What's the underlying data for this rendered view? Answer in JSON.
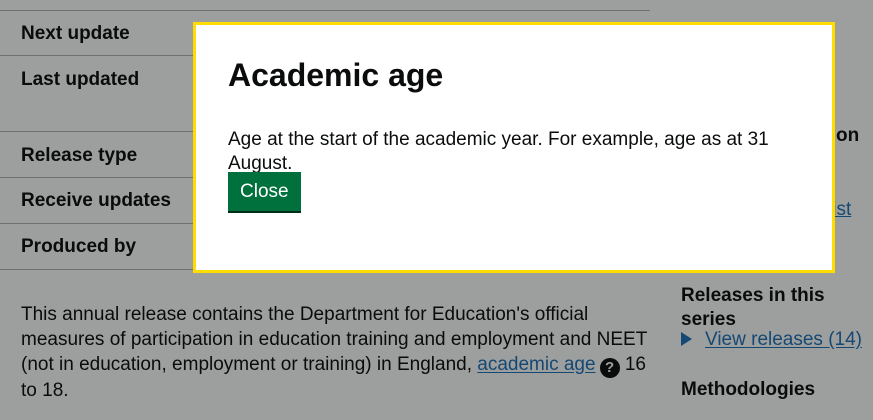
{
  "summary": {
    "rows": [
      {
        "key": "Next update"
      },
      {
        "key": "Last updated"
      },
      {
        "key": "Release type"
      },
      {
        "key": "Receive updates"
      },
      {
        "key": "Produced by"
      }
    ]
  },
  "content": {
    "intro_before_link": "This annual release contains the Department for Education's official measures of participation in education training and employment and NEET (not in education, employment or training) in England, ",
    "link_text": "academic age",
    "help_glyph": "?",
    "intro_after_link": " 16 to 18."
  },
  "sidebar": {
    "partial_heading_fragment": "on",
    "partial_link_fragment": "list",
    "releases_heading": "Releases in this series",
    "view_releases_link": "View releases (14)",
    "methodologies_heading": "Methodologies"
  },
  "modal": {
    "title": "Academic age",
    "text": "Age at the start of the academic year. For example, age as at 31 August.",
    "close_label": "Close"
  },
  "colors": {
    "overlay": "rgba(11,12,12,0.40)",
    "focus_border": "#ffdd00",
    "button_green": "#00703c",
    "link_blue": "#1d70b8"
  }
}
